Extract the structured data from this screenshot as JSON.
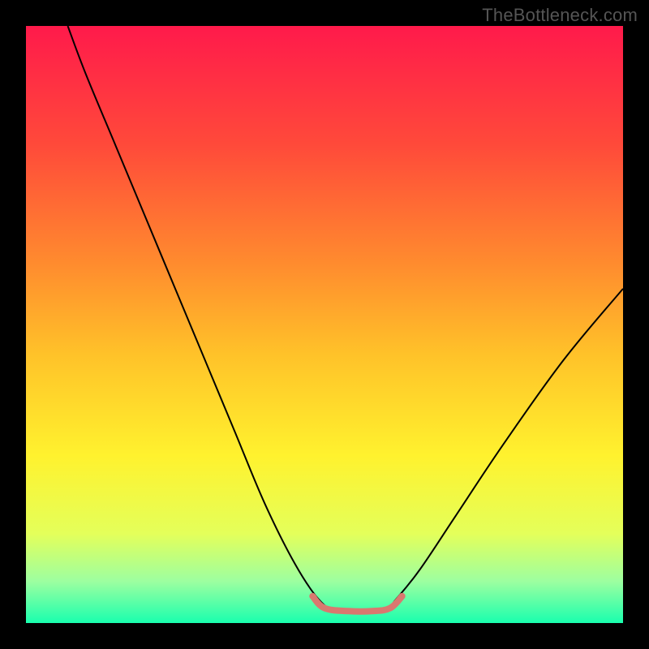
{
  "watermark": "TheBottleneck.com",
  "chart_data": {
    "type": "line",
    "background": {
      "kind": "vertical-gradient",
      "stops": [
        {
          "offset": 0.0,
          "color": "#ff1a4b"
        },
        {
          "offset": 0.2,
          "color": "#ff4a3a"
        },
        {
          "offset": 0.4,
          "color": "#ff8c2e"
        },
        {
          "offset": 0.55,
          "color": "#ffc229"
        },
        {
          "offset": 0.72,
          "color": "#fff22e"
        },
        {
          "offset": 0.85,
          "color": "#e4ff5a"
        },
        {
          "offset": 0.93,
          "color": "#9dffa0"
        },
        {
          "offset": 1.0,
          "color": "#19ffae"
        }
      ]
    },
    "xlim": [
      0,
      100
    ],
    "ylim": [
      0,
      100
    ],
    "xlabel": "",
    "ylabel": "",
    "grid": false,
    "series": [
      {
        "name": "bottleneck-curve",
        "color": "#000000",
        "stroke_width": 2,
        "points": [
          {
            "x": 7,
            "y": 100
          },
          {
            "x": 10,
            "y": 92
          },
          {
            "x": 15,
            "y": 80
          },
          {
            "x": 20,
            "y": 68
          },
          {
            "x": 25,
            "y": 56
          },
          {
            "x": 30,
            "y": 44
          },
          {
            "x": 35,
            "y": 32
          },
          {
            "x": 40,
            "y": 20
          },
          {
            "x": 45,
            "y": 10
          },
          {
            "x": 49,
            "y": 4
          },
          {
            "x": 52,
            "y": 2
          },
          {
            "x": 56,
            "y": 2
          },
          {
            "x": 60,
            "y": 2
          },
          {
            "x": 62,
            "y": 4
          },
          {
            "x": 66,
            "y": 9
          },
          {
            "x": 72,
            "y": 18
          },
          {
            "x": 80,
            "y": 30
          },
          {
            "x": 90,
            "y": 44
          },
          {
            "x": 100,
            "y": 56
          }
        ]
      },
      {
        "name": "bottom-zone-marker",
        "color": "#d9786f",
        "stroke_width": 8,
        "linecap": "round",
        "points": [
          {
            "x": 48,
            "y": 4.5
          },
          {
            "x": 50,
            "y": 2.5
          },
          {
            "x": 54,
            "y": 2
          },
          {
            "x": 58,
            "y": 2
          },
          {
            "x": 61,
            "y": 2.5
          },
          {
            "x": 63,
            "y": 4.5
          }
        ]
      }
    ]
  }
}
